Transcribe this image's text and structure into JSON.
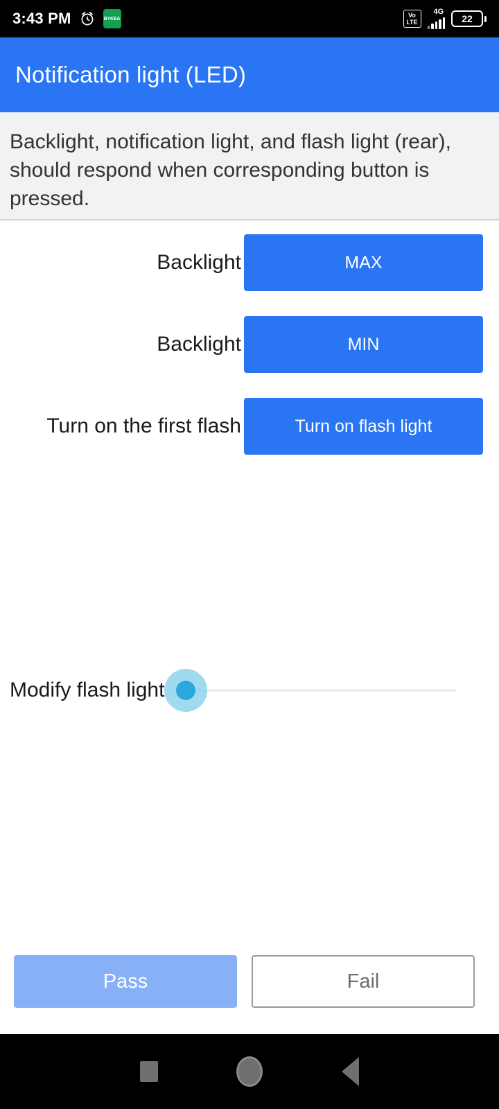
{
  "status_bar": {
    "time": "3:43 PM",
    "alarm_icon": "alarm-clock-icon",
    "app_badge_text": "BYKEA",
    "volte_line1": "Vo",
    "volte_line2": "LTE",
    "network_type": "4G",
    "signal_icon": "signal-bars-icon",
    "battery_percent": "22"
  },
  "app_bar": {
    "title": "Notification light (LED)",
    "background": "#2a75f3"
  },
  "description": {
    "text": "Backlight, notification light, and flash light (rear), should respond when corresponding button is pressed."
  },
  "tests": [
    {
      "label": "Backlight",
      "button": "MAX"
    },
    {
      "label": "Backlight",
      "button": "MIN"
    },
    {
      "label": "Turn on the first flash",
      "button": "Turn on flash light"
    }
  ],
  "slider": {
    "label": "Modify flash light",
    "value": "0",
    "min": "0",
    "max": "100",
    "thumb_color": "#2aa8dd",
    "halo_color": "#8fd3ef",
    "track_color": "#eceded"
  },
  "footer": {
    "pass_label": "Pass",
    "fail_label": "Fail",
    "pass_color": "#87b0f6"
  },
  "nav_bar": {
    "recents_icon": "square-recents-icon",
    "home_icon": "circle-home-icon",
    "back_icon": "triangle-back-icon"
  }
}
